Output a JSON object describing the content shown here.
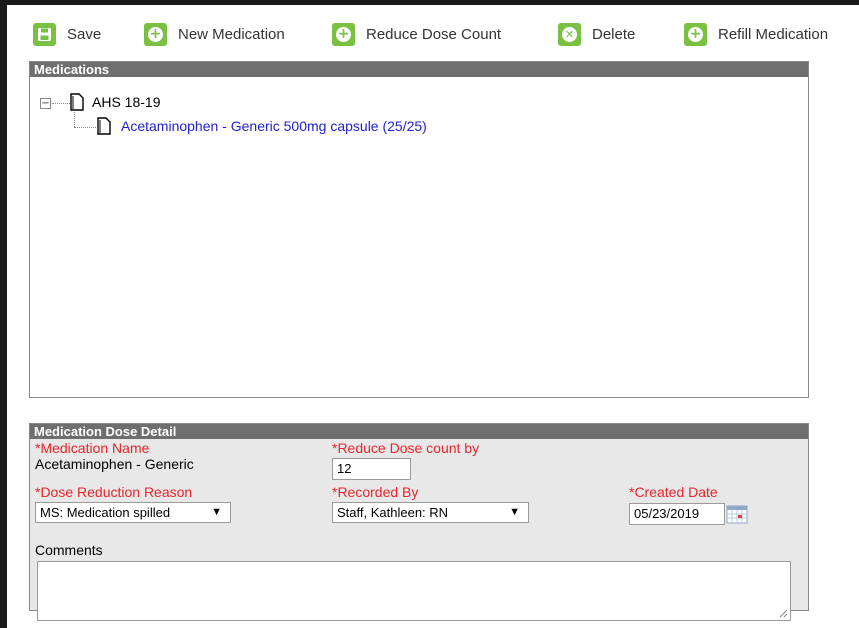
{
  "toolbar": {
    "buttons": [
      {
        "label": "Save",
        "icon": "save-icon"
      },
      {
        "label": "New Medication",
        "icon": "plus-icon"
      },
      {
        "label": "Reduce Dose Count",
        "icon": "plus-icon"
      },
      {
        "label": "Delete",
        "icon": "x-icon"
      },
      {
        "label": "Refill Medication",
        "icon": "plus-icon"
      }
    ]
  },
  "medications": {
    "header": "Medications",
    "tree": {
      "toggle": "−",
      "root_label": "AHS 18-19",
      "child_label": "Acetaminophen - Generic 500mg capsule (25/25)"
    }
  },
  "detail": {
    "header": "Medication Dose Detail",
    "medication_name_label": "*Medication Name",
    "medication_name_value": "Acetaminophen - Generic",
    "reduce_count_label": "*Reduce Dose count by",
    "reduce_count_value": "12",
    "reason_label": "*Dose Reduction Reason",
    "reason_value": "MS: Medication spilled",
    "recorded_by_label": "*Recorded By",
    "recorded_by_value": "Staff, Kathleen: RN",
    "created_date_label": "*Created Date",
    "created_date_value": "05/23/2019",
    "comments_label": "Comments",
    "comments_value": ""
  },
  "colors": {
    "accent_green": "#7ac143",
    "header_gray": "#6e6e6e",
    "required_red": "#e8262b",
    "link_blue": "#2222cc",
    "detail_bg": "#e8e8e8"
  }
}
